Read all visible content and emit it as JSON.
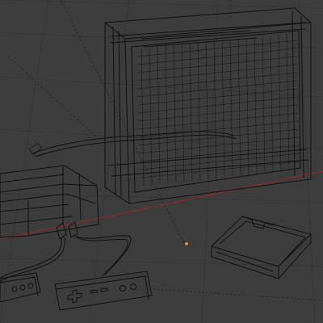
{
  "viewport": {
    "mode": "wireframe",
    "shading": "wireframe",
    "grid": true,
    "axis_colors": {
      "x_axis": "#8b2a2a"
    },
    "background": "#3d3d3d",
    "wire_color": "#111111",
    "origin_marker_color": "#d98a4a"
  },
  "scene": {
    "objects": [
      {
        "name": "tv-set",
        "icon": "monitor-icon"
      },
      {
        "name": "console",
        "icon": "cube-icon"
      },
      {
        "name": "controller-1",
        "icon": "gamepad-icon"
      },
      {
        "name": "controller-2",
        "icon": "gamepad-icon"
      },
      {
        "name": "cartridge",
        "icon": "cartridge-icon"
      },
      {
        "name": "av-cable",
        "icon": "cable-icon"
      }
    ]
  }
}
